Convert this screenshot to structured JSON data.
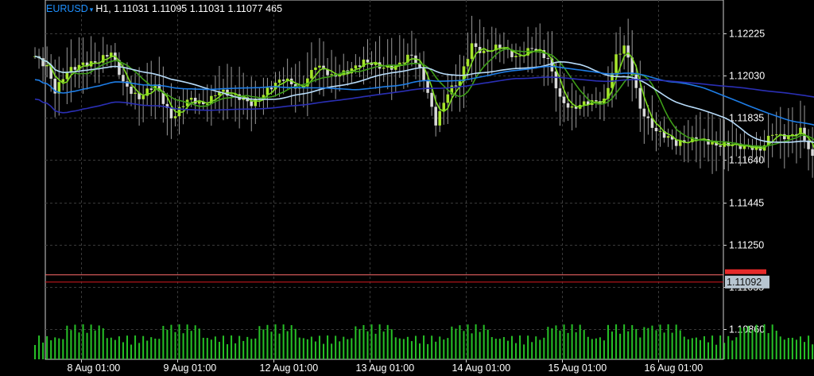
{
  "header": {
    "symbol": "EURUSD",
    "arrow": "▾",
    "info": "H1, 1.11031 1.11095 1.11031 1.11077 465"
  },
  "price_tag": "1.11092",
  "colors": {
    "background": "#000000",
    "grid": "#3a3a3a",
    "axis": "#d0d0d0",
    "bull": "#a8e62c",
    "bear": "#d9d9d9",
    "volume": "#27c027",
    "bid_line": "#c0171c",
    "ask_line": "#ff6a6a",
    "tag_bg": "#b8c6d1",
    "ma_fast": "#7ddc1e",
    "ma_mid": "#3e9d18",
    "ma_light": "#b8dcfa",
    "ma_blue": "#1e7de6",
    "ma_navy": "#2a2fb4"
  },
  "chart_data": {
    "type": "candlestick",
    "symbol": "EURUSD",
    "timeframe": "H1",
    "ohlc_last": {
      "open": 1.11031,
      "high": 1.11095,
      "low": 1.11031,
      "close": 1.11077,
      "volume": 465
    },
    "current_price": 1.11092,
    "y_ticks": [
      1.12225,
      1.1203,
      1.11835,
      1.1164,
      1.11445,
      1.1125,
      1.11055,
      1.1086
    ],
    "y_tick_labels": [
      "1.12225",
      "1.12030",
      "1.11835",
      "1.11640",
      "1.11445",
      "1.11250",
      "1.11055",
      "1.10860"
    ],
    "ylim": [
      1.1072,
      1.1238
    ],
    "x_ticks": [
      "8 Aug 01:00",
      "9 Aug 01:00",
      "12 Aug 01:00",
      "13 Aug 01:00",
      "14 Aug 01:00",
      "15 Aug 01:00",
      "16 Aug 01:00"
    ],
    "bars_per_day": 24,
    "grid": true,
    "price_path": [
      [
        0,
        1.1212
      ],
      [
        3,
        1.1208
      ],
      [
        5,
        1.1196
      ],
      [
        8,
        1.1204
      ],
      [
        12,
        1.1209
      ],
      [
        16,
        1.121
      ],
      [
        19,
        1.1213
      ],
      [
        22,
        1.12
      ],
      [
        26,
        1.1193
      ],
      [
        30,
        1.1198
      ],
      [
        34,
        1.1184
      ],
      [
        38,
        1.1192
      ],
      [
        42,
        1.1189
      ],
      [
        46,
        1.1197
      ],
      [
        50,
        1.1193
      ],
      [
        54,
        1.119
      ],
      [
        58,
        1.1197
      ],
      [
        62,
        1.1201
      ],
      [
        66,
        1.1197
      ],
      [
        70,
        1.1208
      ],
      [
        74,
        1.1202
      ],
      [
        78,
        1.1206
      ],
      [
        82,
        1.1209
      ],
      [
        86,
        1.1207
      ],
      [
        90,
        1.1208
      ],
      [
        94,
        1.1212
      ],
      [
        97,
        1.1202
      ],
      [
        100,
        1.1182
      ],
      [
        103,
        1.1195
      ],
      [
        106,
        1.12
      ],
      [
        109,
        1.1218
      ],
      [
        112,
        1.1214
      ],
      [
        116,
        1.1216
      ],
      [
        120,
        1.1212
      ],
      [
        124,
        1.1216
      ],
      [
        128,
        1.121
      ],
      [
        131,
        1.1193
      ],
      [
        134,
        1.1188
      ],
      [
        138,
        1.119
      ],
      [
        142,
        1.1192
      ],
      [
        145,
        1.1212
      ],
      [
        147,
        1.1216
      ],
      [
        149,
        1.1204
      ],
      [
        151,
        1.1188
      ],
      [
        155,
        1.1178
      ],
      [
        160,
        1.1171
      ],
      [
        165,
        1.1175
      ],
      [
        170,
        1.117
      ],
      [
        174,
        1.1172
      ],
      [
        178,
        1.117
      ],
      [
        181,
        1.1168
      ],
      [
        184,
        1.1177
      ],
      [
        188,
        1.1175
      ],
      [
        191,
        1.1177
      ],
      [
        194,
        1.1165
      ],
      [
        198,
        1.115
      ],
      [
        202,
        1.1137
      ],
      [
        206,
        1.114
      ],
      [
        210,
        1.1145
      ],
      [
        214,
        1.1144
      ],
      [
        218,
        1.1146
      ],
      [
        222,
        1.115
      ],
      [
        226,
        1.1151
      ],
      [
        230,
        1.115
      ],
      [
        232,
        1.1145
      ],
      [
        235,
        1.1113
      ],
      [
        238,
        1.1102
      ],
      [
        241,
        1.1106
      ],
      [
        244,
        1.111
      ],
      [
        247,
        1.1106
      ],
      [
        249,
        1.1108
      ]
    ],
    "ma_specs": [
      {
        "period": 4,
        "color": "ma_fast"
      },
      {
        "period": 10,
        "color": "ma_mid"
      },
      {
        "period": 30,
        "color": "ma_light"
      },
      {
        "period": 60,
        "color": "ma_blue"
      },
      {
        "period": 120,
        "color": "ma_navy"
      }
    ]
  }
}
